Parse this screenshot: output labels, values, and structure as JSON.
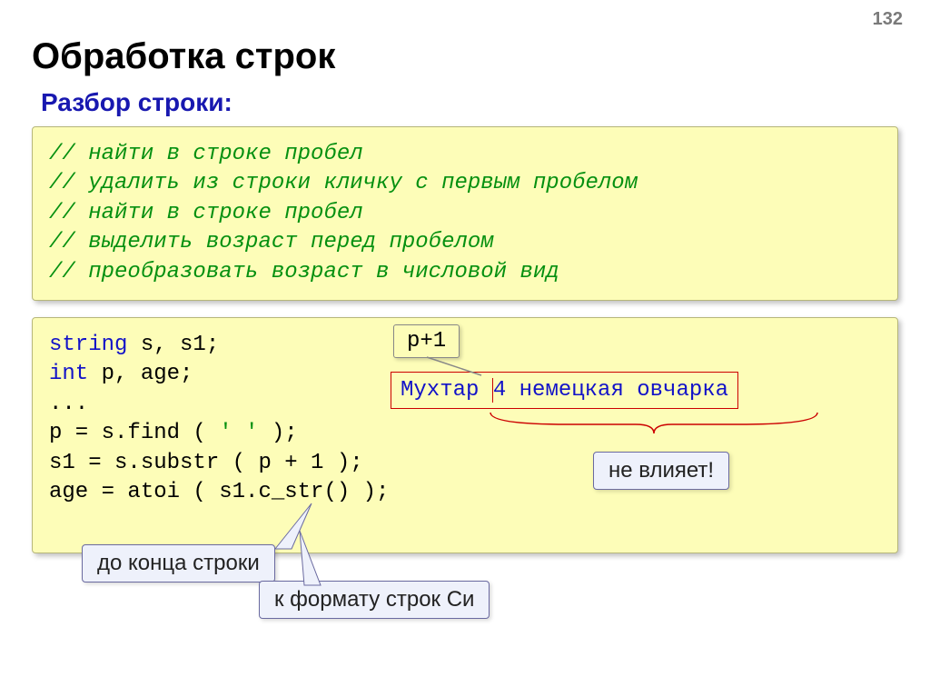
{
  "page_number": "132",
  "title": "Обработка строк",
  "subtitle": "Разбор строки:",
  "comments": {
    "c1": "// найти в строке пробел",
    "c2": "// удалить из строки кличку с первым пробелом",
    "c3": "// найти в строке пробел",
    "c4": "// выделить возраст перед пробелом",
    "c5": "// преобразовать возраст в числовой вид"
  },
  "code": {
    "kw_string": "string",
    "decl1_rest": " s, s1;",
    "kw_int": "int",
    "decl2_rest": " p, age;",
    "dots": "...",
    "l4a": "p = s.find ( ",
    "l4b": "' '",
    "l4c": " );",
    "l5a": "s1 = s.substr ( p + ",
    "l5one": "1",
    "l5b": " );",
    "l6": "age = atoi ( s1.c_str() );"
  },
  "tag_p1": "p+1",
  "sample": {
    "part1": "Мухтар ",
    "part2": "4 немецкая овчарка"
  },
  "callouts": {
    "noimpact": "не влияет!",
    "to_end": "до конца строки",
    "to_c": "к формату строк Си"
  }
}
